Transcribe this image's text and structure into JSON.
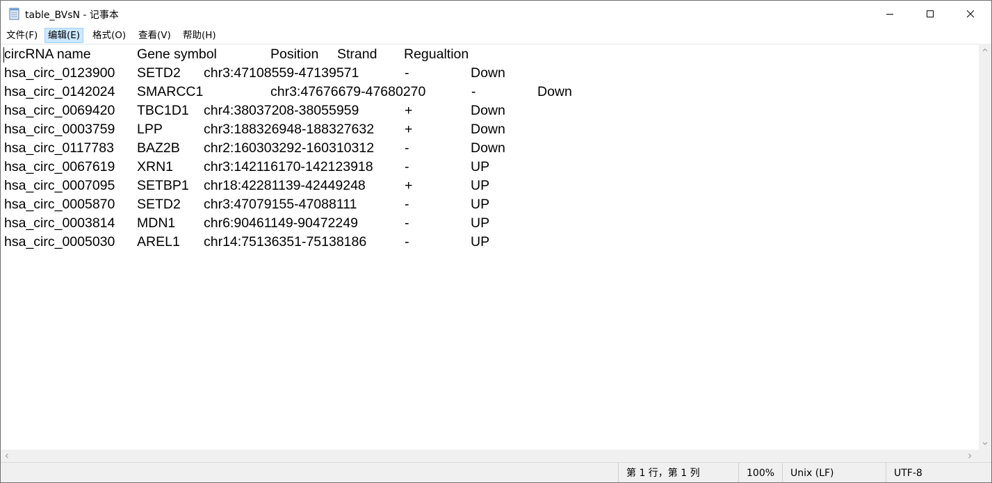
{
  "window": {
    "title": "table_BVsN - 记事本",
    "icon": "notepad-icon"
  },
  "menu": [
    {
      "label": "文件(F)",
      "active": false
    },
    {
      "label": "编辑(E)",
      "active": true
    },
    {
      "label": "格式(O)",
      "active": false
    },
    {
      "label": "查看(V)",
      "active": false
    },
    {
      "label": "帮助(H)",
      "active": false
    }
  ],
  "document": {
    "header": {
      "col1": "circRNA name",
      "col2": "Gene symbol",
      "col3": "Position",
      "col4": "Strand",
      "col5": "Regualtion"
    },
    "rows": [
      {
        "name": "hsa_circ_0123900",
        "gene": "SETD2",
        "position": "chr3:47108559-47139571",
        "strand": "-",
        "regulation": "Down"
      },
      {
        "name": "hsa_circ_0142024",
        "gene": "SMARCC1",
        "position": "chr3:47676679-47680270",
        "strand": "-",
        "regulation": "Down"
      },
      {
        "name": "hsa_circ_0069420",
        "gene": "TBC1D1",
        "position": "chr4:38037208-38055959",
        "strand": "+",
        "regulation": "Down"
      },
      {
        "name": "hsa_circ_0003759",
        "gene": "LPP",
        "position": "chr3:188326948-188327632",
        "strand": "+",
        "regulation": "Down"
      },
      {
        "name": "hsa_circ_0117783",
        "gene": "BAZ2B",
        "position": "chr2:160303292-160310312",
        "strand": "-",
        "regulation": "Down"
      },
      {
        "name": "hsa_circ_0067619",
        "gene": "XRN1",
        "position": "chr3:142116170-142123918",
        "strand": "-",
        "regulation": "UP"
      },
      {
        "name": "hsa_circ_0007095",
        "gene": "SETBP1",
        "position": "chr18:42281139-42449248",
        "strand": "+",
        "regulation": "UP"
      },
      {
        "name": "hsa_circ_0005870",
        "gene": "SETD2",
        "position": "chr3:47079155-47088111",
        "strand": "-",
        "regulation": "UP"
      },
      {
        "name": "hsa_circ_0003814",
        "gene": "MDN1",
        "position": "chr6:90461149-90472249",
        "strand": "-",
        "regulation": "UP"
      },
      {
        "name": "hsa_circ_0005030",
        "gene": "AREL1",
        "position": "chr14:75136351-75138186",
        "strand": "-",
        "regulation": "UP"
      }
    ]
  },
  "status": {
    "cursor": "第 1 行，第 1 列",
    "zoom": "100%",
    "line_ending": "Unix (LF)",
    "encoding": "UTF-8"
  }
}
